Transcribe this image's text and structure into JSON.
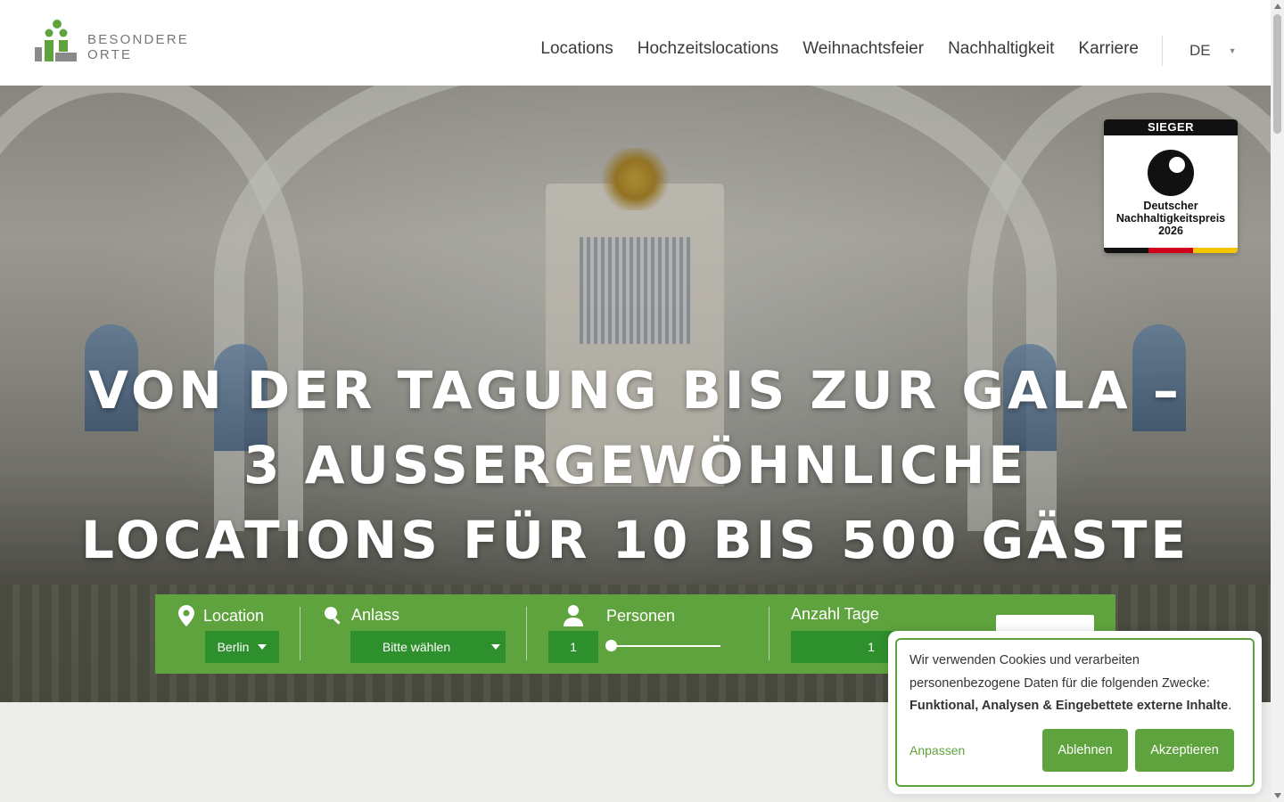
{
  "brand": {
    "name": "BESONDERE ORTE",
    "logo_colors": [
      "#5ea33d",
      "#8a8a8a"
    ]
  },
  "nav": {
    "items": [
      {
        "label": "Locations"
      },
      {
        "label": "Hochzeitslocations"
      },
      {
        "label": "Weihnachtsfeier"
      },
      {
        "label": "Nachhaltigkeit"
      },
      {
        "label": "Karriere"
      }
    ],
    "language": "DE"
  },
  "hero": {
    "headline_lines": [
      "VON DER TAGUNG BIS ZUR GALA –",
      "3 AUSSERGEWÖHNLICHE",
      "LOCATIONS FÜR 10 BIS 500 GÄSTE"
    ]
  },
  "badge": {
    "top": "SIEGER",
    "line1": "Deutscher",
    "line2": "Nachhaltigkeitspreis",
    "line3": "2026",
    "stripe_colors": [
      "#111111",
      "#d0021b",
      "#f5c400"
    ]
  },
  "search": {
    "location": {
      "label": "Location",
      "value": "Berlin",
      "icon": "map-pin-icon"
    },
    "occasion": {
      "label": "Anlass",
      "value": "Bitte wählen",
      "icon": "search-icon"
    },
    "persons": {
      "label": "Personen",
      "value": "1",
      "icon": "person-icon",
      "slider_fraction": 0
    },
    "days": {
      "label": "Anzahl Tage",
      "value": "1"
    }
  },
  "cookie": {
    "text_intro": "Wir verwenden Cookies und verarbeiten personenbezogene Daten für die folgenden Zwecke: ",
    "text_purposes": "Funktional, Analysen & Eingebettete externe Inhalte",
    "text_end": ".",
    "customize": "Anpassen",
    "decline": "Ablehnen",
    "accept": "Akzeptieren"
  },
  "colors": {
    "accent": "#5ea33d",
    "field": "#2e8f2d"
  }
}
